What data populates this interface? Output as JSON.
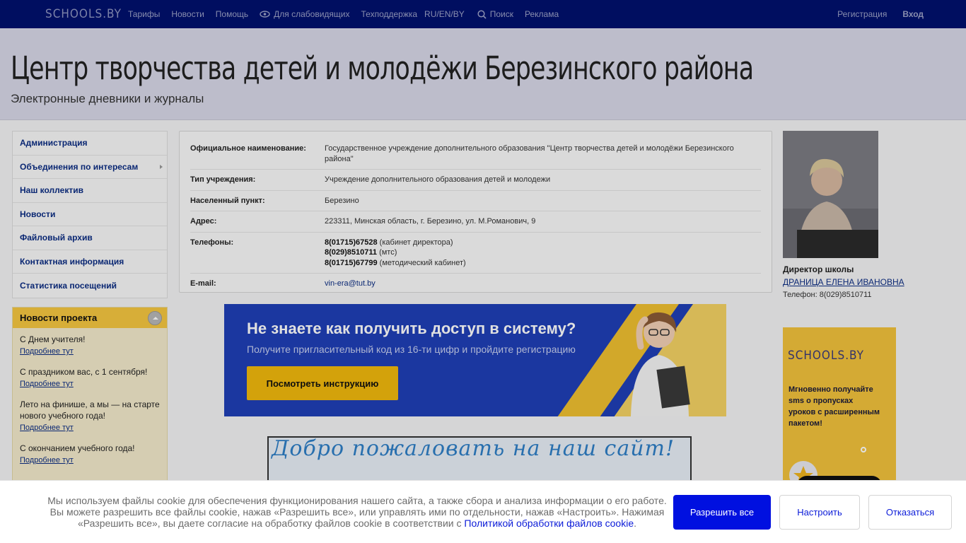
{
  "topnav": {
    "logo": "SCHOOLS.BY",
    "links": [
      "Тарифы",
      "Новости",
      "Помощь",
      "Для слабовидящих",
      "Техподдержка",
      "RU/EN/BY",
      "Поиск",
      "Реклама"
    ],
    "register": "Регистрация",
    "login": "Вход"
  },
  "header": {
    "title": "Центр творчества детей и молодёжи Березинского района",
    "subtitle": "Электронные дневники и журналы"
  },
  "sidebar": {
    "items": [
      {
        "label": "Администрация"
      },
      {
        "label": "Объединения по интересам"
      },
      {
        "label": "Наш коллектив"
      },
      {
        "label": "Новости"
      },
      {
        "label": "Файловый архив"
      },
      {
        "label": "Контактная информация"
      },
      {
        "label": "Статистика посещений"
      }
    ]
  },
  "project_news": {
    "title": "Новости проекта",
    "items": [
      {
        "text": "С Днем учителя!",
        "link": "Подробнее тут"
      },
      {
        "text": "С праздником вас, с 1 сентября!",
        "link": "Подробнее тут"
      },
      {
        "text": "Лето на финише, а мы — на старте нового учебного года!",
        "link": "Подробнее тут"
      },
      {
        "text": "С окончанием учебного года!",
        "link": "Подробнее тут"
      }
    ]
  },
  "info": {
    "official_name_label": "Официальное наименование:",
    "official_name": "Государственное учреждение дополнительного образования \"Центр творчества детей и молодёжи Березинского района\"",
    "type_label": "Тип учреждения:",
    "type": "Учреждение дополнительного образования детей и молодежи",
    "locality_label": "Населенный пункт:",
    "locality": "Березино",
    "address_label": "Адрес:",
    "address": "223311, Минская область, г. Березино, ул. М.Романович, 9",
    "phones_label": "Телефоны:",
    "phones": [
      {
        "number": "8(01715)67528",
        "note": " (кабинет директора)"
      },
      {
        "number": "8(029)8510711",
        "note": " (мтс)"
      },
      {
        "number": "8(01715)67799",
        "note": " (методический кабинет)"
      }
    ],
    "email_label": "E-mail:",
    "email": "vin-era@tut.by"
  },
  "banner": {
    "title": "Не знаете как получить доступ в систему?",
    "subtitle": "Получите пригласительный код из 16-ти цифр и пройдите регистрацию",
    "button": "Посмотреть инструкцию"
  },
  "welcome_banner": "Добро пожаловать на наш сайт!",
  "director": {
    "role": "Директор школы",
    "name": "ДРАНИЦА ЕЛЕНА ИВАНОВНА",
    "phone": "Телефон: 8(029)8510711"
  },
  "ad": {
    "logo": "SCHOOLS.BY",
    "text": "Мгновенно получайте sms о пропусках уроков с расширенным пакетом!"
  },
  "cookie": {
    "message": "Мы используем файлы cookie для обеспечения функционирования нашего сайта, а также сбора и анализа информации о его работе. Вы можете разрешить все файлы cookie, нажав «Разрешить все», или управлять ими по отдельности, нажав «Настроить». Нажимая «Разрешить все», вы даете согласие на обработку файлов cookie в соответствии с",
    "policy_link": "Политикой обработки файлов cookie",
    "period": ".",
    "allow_all": "Разрешить все",
    "configure": "Настроить",
    "decline": "Отказаться"
  },
  "colors": {
    "topbar": "#00106e",
    "link": "#0c2d83",
    "accent_yellow": "#f5c640",
    "cookie_primary": "#0010e0"
  }
}
